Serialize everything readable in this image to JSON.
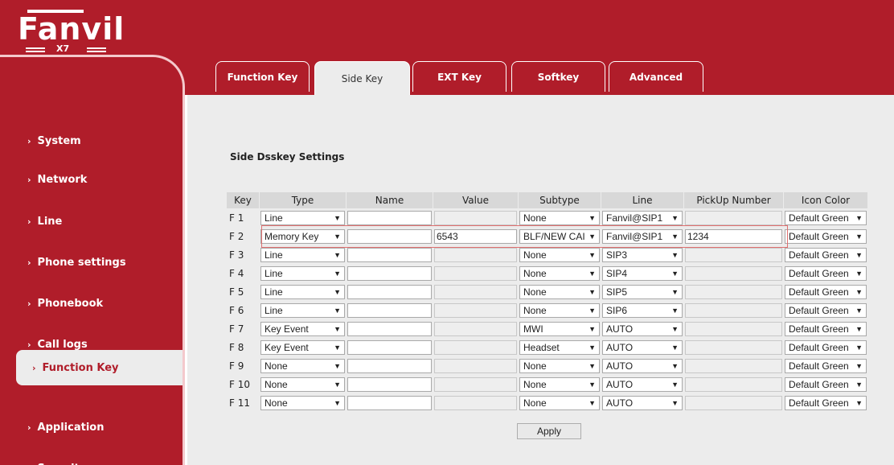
{
  "brand": {
    "name": "Fanvil",
    "model": "X7"
  },
  "colors": {
    "brand_red": "#b01d2a",
    "panel_bg": "#ececec",
    "highlight": "#e07070"
  },
  "sidebar": {
    "items": [
      {
        "label": "System"
      },
      {
        "label": "Network"
      },
      {
        "label": "Line"
      },
      {
        "label": "Phone settings"
      },
      {
        "label": "Phonebook"
      },
      {
        "label": "Call logs"
      },
      {
        "label": "Function Key",
        "active": true
      },
      {
        "label": "Application"
      },
      {
        "label": "Security"
      }
    ]
  },
  "tabs": [
    {
      "label": "Function Key"
    },
    {
      "label": "Side Key",
      "active": true
    },
    {
      "label": "EXT Key"
    },
    {
      "label": "Softkey"
    },
    {
      "label": "Advanced"
    }
  ],
  "section_title": "Side Dsskey Settings",
  "table": {
    "headers": [
      "Key",
      "Type",
      "Name",
      "Value",
      "Subtype",
      "Line",
      "PickUp Number",
      "Icon Color"
    ],
    "rows": [
      {
        "key": "F 1",
        "type": "Line",
        "name": "",
        "value": "",
        "subtype": "None",
        "line": "Fanvil@SIP1",
        "pickup": "",
        "icon": "Default Green"
      },
      {
        "key": "F 2",
        "type": "Memory Key",
        "name": "",
        "value": "6543",
        "subtype": "BLF/NEW CAI",
        "line": "Fanvil@SIP1",
        "pickup": "1234",
        "icon": "Default Green"
      },
      {
        "key": "F 3",
        "type": "Line",
        "name": "",
        "value": "",
        "subtype": "None",
        "line": "SIP3",
        "pickup": "",
        "icon": "Default Green"
      },
      {
        "key": "F 4",
        "type": "Line",
        "name": "",
        "value": "",
        "subtype": "None",
        "line": "SIP4",
        "pickup": "",
        "icon": "Default Green"
      },
      {
        "key": "F 5",
        "type": "Line",
        "name": "",
        "value": "",
        "subtype": "None",
        "line": "SIP5",
        "pickup": "",
        "icon": "Default Green"
      },
      {
        "key": "F 6",
        "type": "Line",
        "name": "",
        "value": "",
        "subtype": "None",
        "line": "SIP6",
        "pickup": "",
        "icon": "Default Green"
      },
      {
        "key": "F 7",
        "type": "Key Event",
        "name": "",
        "value": "",
        "subtype": "MWI",
        "line": "AUTO",
        "pickup": "",
        "icon": "Default Green"
      },
      {
        "key": "F 8",
        "type": "Key Event",
        "name": "",
        "value": "",
        "subtype": "Headset",
        "line": "AUTO",
        "pickup": "",
        "icon": "Default Green"
      },
      {
        "key": "F 9",
        "type": "None",
        "name": "",
        "value": "",
        "subtype": "None",
        "line": "AUTO",
        "pickup": "",
        "icon": "Default Green"
      },
      {
        "key": "F 10",
        "type": "None",
        "name": "",
        "value": "",
        "subtype": "None",
        "line": "AUTO",
        "pickup": "",
        "icon": "Default Green"
      },
      {
        "key": "F 11",
        "type": "None",
        "name": "",
        "value": "",
        "subtype": "None",
        "line": "AUTO",
        "pickup": "",
        "icon": "Default Green"
      }
    ]
  },
  "apply_label": "Apply"
}
